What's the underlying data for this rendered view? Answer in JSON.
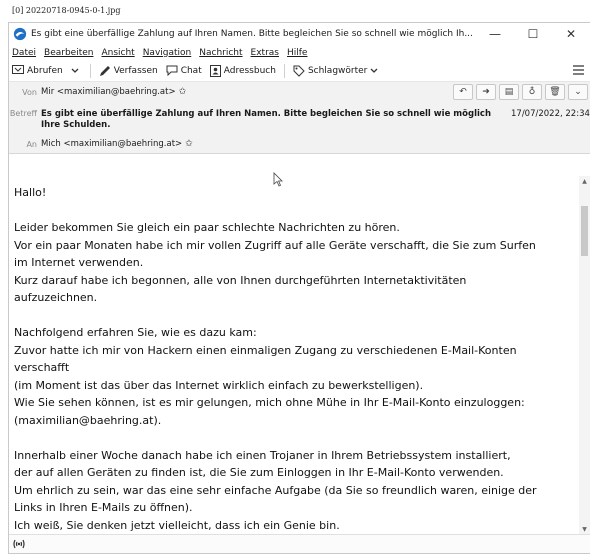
{
  "file_label": "[0] 20220718-0945-0-1.jpg",
  "window": {
    "title": "Es gibt eine überfällige Zahlung auf Ihren Namen. Bitte begleichen Sie so schnell wie möglich Ih...",
    "minimize": "—",
    "maximize": "☐",
    "close": "✕"
  },
  "menu": [
    "Datei",
    "Bearbeiten",
    "Ansicht",
    "Navigation",
    "Nachricht",
    "Extras",
    "Hilfe"
  ],
  "toolbar": {
    "abrufen": "Abrufen",
    "verfassen": "Verfassen",
    "chat": "Chat",
    "adressbuch": "Adressbuch",
    "schlagwoerter": "Schlagwörter"
  },
  "header": {
    "from_label": "Von",
    "from": "Mir <maximilian@baehring.at>",
    "subject_label": "Betreff",
    "subject": "Es gibt eine überfällige Zahlung auf Ihren Namen. Bitte begleichen Sie so schnell wie möglich Ihre Schulden.",
    "date": "17/07/2022, 22:34",
    "to_label": "An",
    "to": "Mich <maximilian@baehring.at>"
  },
  "body": {
    "p1": [
      "Hallo!"
    ],
    "p2": [
      "Leider bekommen Sie gleich ein paar schlechte Nachrichten zu hören.",
      "Vor ein paar Monaten habe ich mir vollen Zugriff auf alle Geräte verschafft, die Sie zum Surfen",
      "im Internet verwenden.",
      "Kurz darauf habe ich begonnen, alle von Ihnen durchgeführten Internetaktivitäten",
      "aufzuzeichnen."
    ],
    "p3": [
      "Nachfolgend erfahren Sie, wie es dazu kam:",
      "Zuvor hatte ich mir von Hackern einen einmaligen Zugang zu verschiedenen E-Mail-Konten",
      "verschafft",
      "(im Moment ist das über das Internet wirklich einfach zu bewerkstelligen).",
      "Wie Sie sehen können, ist es mir gelungen, mich ohne Mühe in Ihr E-Mail-Konto einzuloggen:",
      "(maximilian@baehring.at)."
    ],
    "p4": [
      "Innerhalb einer Woche danach habe ich einen Trojaner in Ihrem Betriebssystem installiert,",
      "der auf allen Geräten zu finden ist, die Sie zum Einloggen in Ihr E-Mail-Konto verwenden.",
      "Um ehrlich zu sein, war das eine sehr einfache Aufgabe (da Sie so freundlich waren, einige der",
      "Links in Ihren E-Mails zu öffnen).",
      "Ich weiß, Sie denken jetzt vielleicht, dass ich ein Genie bin."
    ]
  },
  "colors": {
    "accent": "#1f6fc5",
    "header_bg": "#f2f2f2"
  }
}
